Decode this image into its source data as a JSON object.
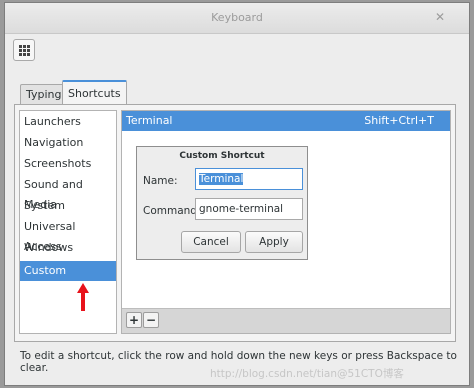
{
  "window": {
    "title": "Keyboard",
    "close_glyph": "✕"
  },
  "tabs": [
    {
      "label": "Typing"
    },
    {
      "label": "Shortcuts"
    }
  ],
  "sidebar": {
    "items": [
      {
        "label": "Launchers"
      },
      {
        "label": "Navigation"
      },
      {
        "label": "Screenshots"
      },
      {
        "label": "Sound and Media"
      },
      {
        "label": "System"
      },
      {
        "label": "Universal Access"
      },
      {
        "label": "Windows"
      },
      {
        "label": "Custom Shortcuts"
      }
    ],
    "selected": "Custom Shortcuts"
  },
  "shortcuts": {
    "rows": [
      {
        "name": "Terminal",
        "accelerator": "Shift+Ctrl+T"
      }
    ],
    "add_label": "+",
    "remove_label": "−"
  },
  "dialog": {
    "title": "Custom Shortcut",
    "name_label": "Name:",
    "name_value": "Terminal",
    "command_label": "Command:",
    "command_value": "gnome-terminal",
    "cancel_label": "Cancel",
    "apply_label": "Apply"
  },
  "hint": "To edit a shortcut, click the row and hold down the new keys or press Backspace to clear.",
  "watermark": "http://blog.csdn.net/tian@51CTO博客",
  "colors": {
    "accent": "#4a90d9",
    "annotation_arrow": "#e8121b"
  },
  "icons": {
    "toolbar": "grid-menu-icon",
    "annotation": "red-arrow-icon"
  }
}
